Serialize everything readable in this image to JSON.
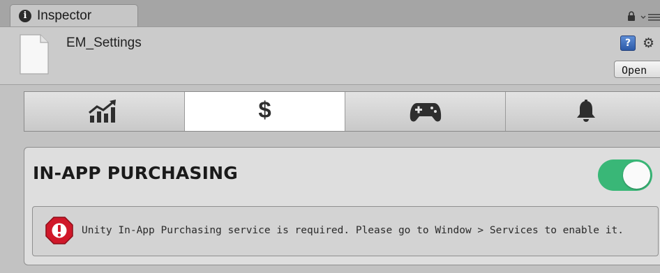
{
  "tab": {
    "label": "Inspector",
    "info_glyph": "i"
  },
  "header": {
    "asset_name": "EM_Settings",
    "open_label": "Open",
    "help_glyph": "?"
  },
  "toolbar": {
    "tabs": [
      {
        "icon": "chart-growth-icon"
      },
      {
        "icon": "dollar-icon",
        "glyph": "$",
        "active": true
      },
      {
        "icon": "gamepad-icon"
      },
      {
        "icon": "bell-icon"
      }
    ]
  },
  "section": {
    "title": "IN-APP PURCHASING",
    "enabled": true,
    "message": "Unity In-App Purchasing service is required. Please go to Window > Services to enable it."
  },
  "colors": {
    "toggle_on": "#39b777",
    "error_red": "#d0182a"
  }
}
